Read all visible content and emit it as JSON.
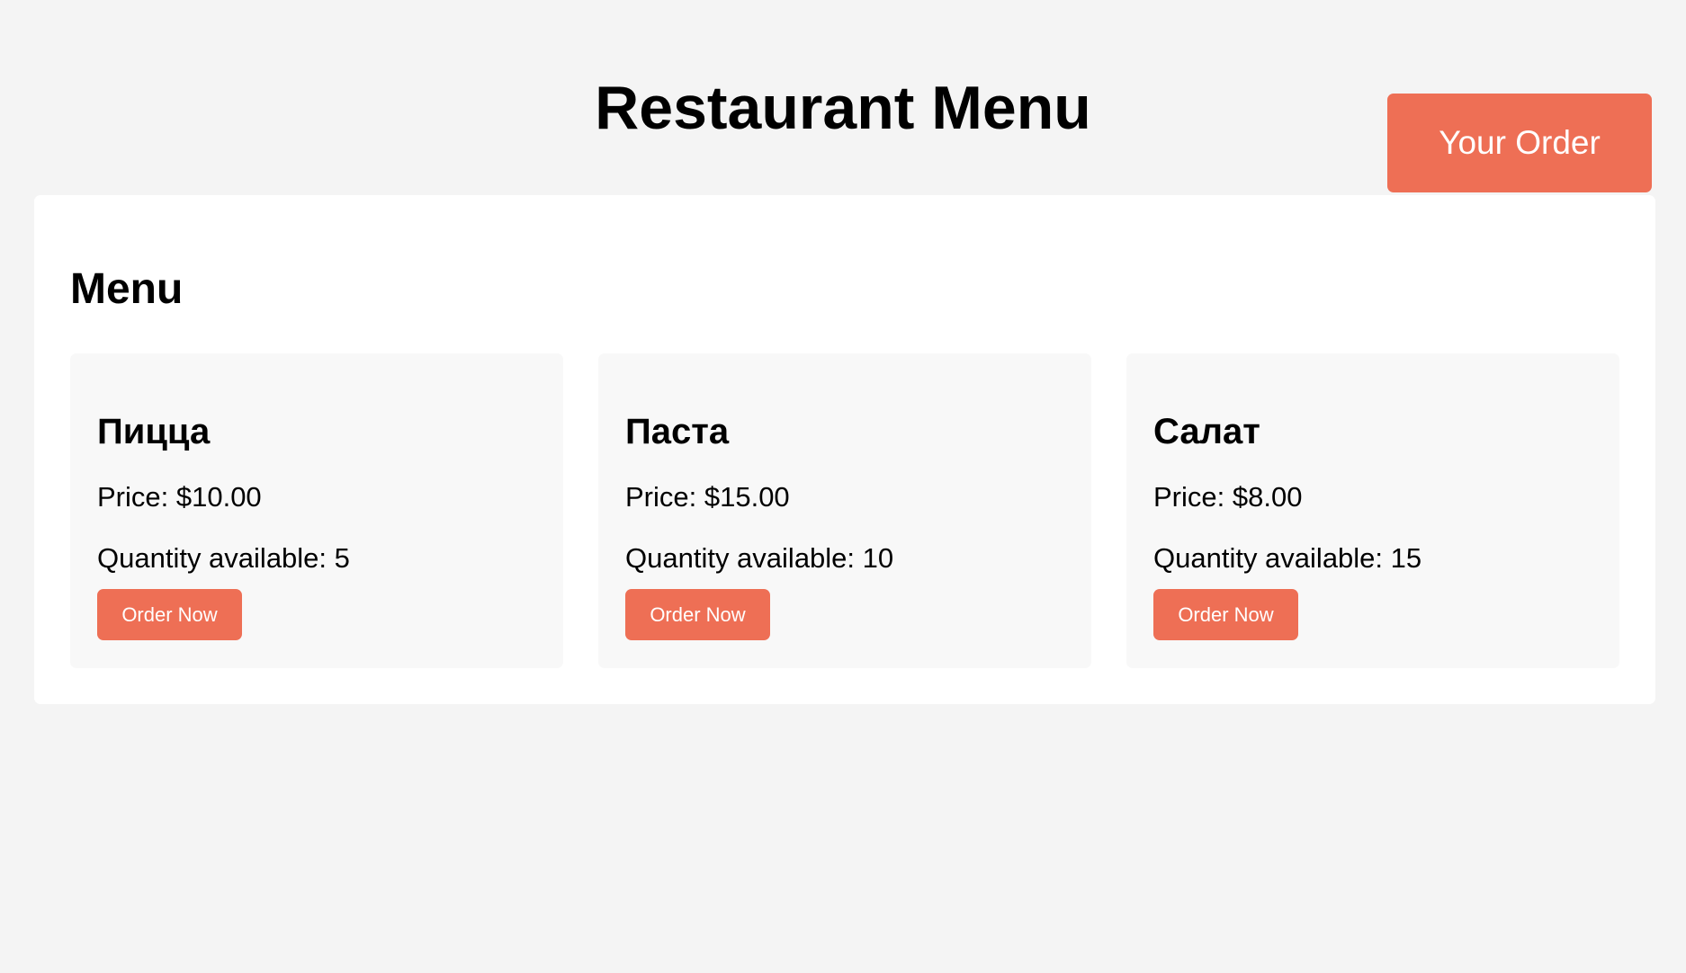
{
  "header": {
    "title": "Restaurant Menu",
    "order_button_label": "Your Order"
  },
  "menu": {
    "heading": "Menu",
    "items": [
      {
        "name": "Пицца",
        "price_text": "Price: $10.00",
        "quantity_text": "Quantity available: 5",
        "button_label": "Order Now"
      },
      {
        "name": "Паста",
        "price_text": "Price: $15.00",
        "quantity_text": "Quantity available: 10",
        "button_label": "Order Now"
      },
      {
        "name": "Салат",
        "price_text": "Price: $8.00",
        "quantity_text": "Quantity available: 15",
        "button_label": "Order Now"
      }
    ]
  },
  "colors": {
    "page_background": "#f4f4f4",
    "panel_background": "#ffffff",
    "card_background": "#f8f8f8",
    "accent": "#ee6f55",
    "button_text": "#ffffff"
  }
}
